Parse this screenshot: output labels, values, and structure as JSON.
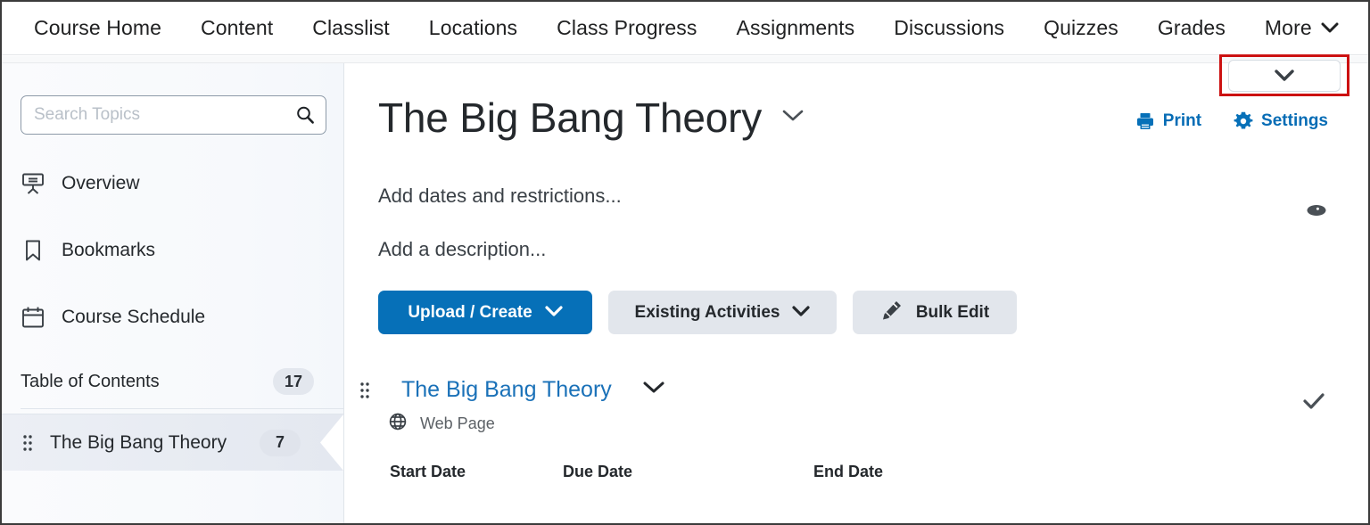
{
  "nav": {
    "items": [
      {
        "label": "Course Home"
      },
      {
        "label": "Content"
      },
      {
        "label": "Classlist"
      },
      {
        "label": "Locations"
      },
      {
        "label": "Class Progress"
      },
      {
        "label": "Assignments"
      },
      {
        "label": "Discussions"
      },
      {
        "label": "Quizzes"
      },
      {
        "label": "Grades"
      },
      {
        "label": "More"
      }
    ]
  },
  "highlight": {
    "note": "red-outlined collapse dropdown button",
    "color": "#cc1111",
    "icon": "chevron-down-icon"
  },
  "sidebar": {
    "search": {
      "placeholder": "Search Topics",
      "value": "",
      "icon": "search-icon"
    },
    "items": [
      {
        "label": "Overview",
        "icon": "presentation-icon"
      },
      {
        "label": "Bookmarks",
        "icon": "bookmark-icon"
      },
      {
        "label": "Course Schedule",
        "icon": "calendar-icon"
      }
    ],
    "toc": {
      "label": "Table of Contents",
      "count": "17"
    },
    "modules": [
      {
        "label": "The Big Bang Theory",
        "count": "7",
        "selected": true
      }
    ]
  },
  "main": {
    "title": "The Big Bang Theory",
    "title_chevron": "chevron-down-icon",
    "tools": [
      {
        "label": "Print",
        "icon": "printer-icon"
      },
      {
        "label": "Settings",
        "icon": "gear-icon"
      }
    ],
    "visibility_icon": "eye-icon",
    "dates_link": "Add dates and restrictions...",
    "description_link": "Add a description...",
    "buttons": [
      {
        "label": "Upload / Create",
        "icon": "chevron-down-icon",
        "style": "primary"
      },
      {
        "label": "Existing Activities",
        "icon": "chevron-down-icon",
        "style": "secondary"
      },
      {
        "label": "Bulk Edit",
        "icon": "pencil-icon",
        "style": "secondary"
      }
    ],
    "content_item": {
      "title": "The Big Bang Theory",
      "type": "Web Page",
      "type_icon": "globe-icon",
      "drag_icon": "drag-handle-icon",
      "chevron": "chevron-down-icon",
      "status_icon": "checkmark-icon"
    },
    "date_columns": [
      "Start Date",
      "Due Date",
      "End Date"
    ]
  },
  "colors": {
    "accent_blue": "#0670b8",
    "link_blue": "#1a71b8",
    "highlight_red": "#cc1111",
    "text": "#24282c"
  }
}
